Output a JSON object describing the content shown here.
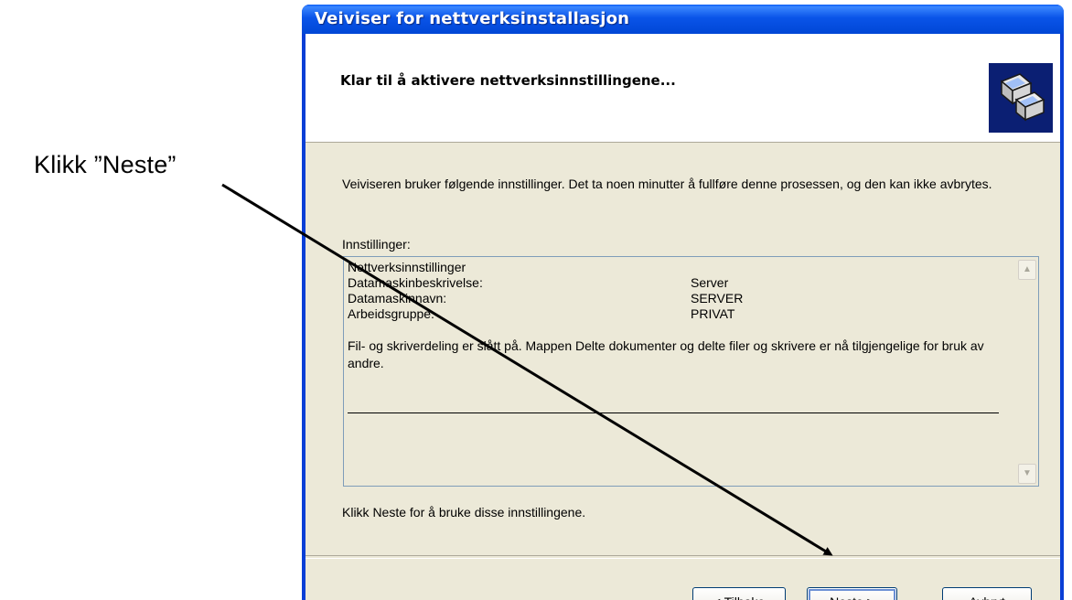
{
  "annotation": {
    "text": "Klikk ”Neste”"
  },
  "window": {
    "title": "Veiviser for nettverksinstallasjon",
    "header_title": "Klar til å aktivere nettverksinnstillingene...",
    "intro_text": "Veiviseren bruker følgende innstillinger. Det ta noen minutter å fullføre denne prosessen, og den kan ikke avbrytes.",
    "settings_label": "Innstillinger:",
    "settings": {
      "heading": "Nettverksinnstillinger",
      "rows": [
        {
          "key": "Datamaskinbeskrivelse:",
          "value": "Server"
        },
        {
          "key": "Datamaskinnavn:",
          "value": "SERVER"
        },
        {
          "key": "Arbeidsgruppe:",
          "value": "PRIVAT"
        }
      ],
      "note": "Fil- og skriverdeling er slått på. Mappen Delte dokumenter og delte filer og skrivere er nå tilgjengelige for bruk av andre."
    },
    "footer_text": "Klikk Neste for å bruke disse innstillingene.",
    "buttons": {
      "back": "< Tilbake",
      "next": "Neste >",
      "cancel": "Avbryt"
    }
  },
  "icons": {
    "header": "network-computers-icon",
    "scroll_up": "scroll-up-arrow-icon",
    "scroll_down": "scroll-down-arrow-icon"
  },
  "colors": {
    "title_bar": "#0a54e8",
    "dialog_bg": "#ece9d8",
    "button_border": "#003c74"
  }
}
